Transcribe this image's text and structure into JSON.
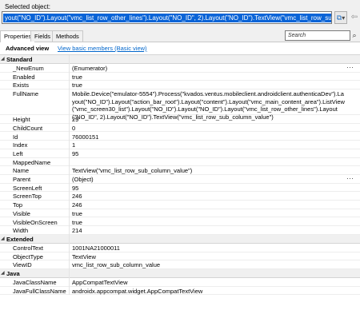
{
  "header": {
    "selected_label": "Selected object:",
    "selected_value": "yout(\"NO_ID\").Layout(\"vmc_list_row_other_lines\").Layout(\"NO_ID\", 2).Layout(\"NO_ID\").TextView(\"vmc_list_row_sub_column_value\")",
    "dropdown_glyph": "▾",
    "copy_glyph": "⧉",
    "back_glyph": "⇦"
  },
  "tabs": [
    "Properties",
    "Fields",
    "Methods"
  ],
  "search": {
    "placeholder": "Search",
    "icon": "⌕"
  },
  "advanced": {
    "title": "Advanced view",
    "link": "View basic members (Basic view)"
  },
  "sections": [
    {
      "title": "Standard",
      "caret": "◢",
      "rows": [
        {
          "name": "_NewEnum",
          "value": "(Enumerator)",
          "dots": "···"
        },
        {
          "name": "Enabled",
          "value": "true"
        },
        {
          "name": "Exists",
          "value": "true"
        },
        {
          "name": "FullName",
          "value": "Mobile.Device(\"emulator-5554\").Process(\"kvados.ventus.mobileclient.androidclient.authenticaDev\").Layout(\"NO_ID\").Layout(\"action_bar_root\").Layout(\"content\").Layout(\"vmc_main_content_area\").ListView(\"vmc_screen30_list\").Layout(\"NO_ID\").Layout(\"NO_ID\").Layout(\"vmc_list_row_other_lines\").Layout(\"NO_ID\", 2).Layout(\"NO_ID\").TextView(\"vmc_list_row_sub_column_value\")"
        },
        {
          "name": "Height",
          "value": "29"
        },
        {
          "name": "ChildCount",
          "value": "0"
        },
        {
          "name": "Id",
          "value": "76000151"
        },
        {
          "name": "Index",
          "value": "1"
        },
        {
          "name": "Left",
          "value": "95"
        },
        {
          "name": "MappedName",
          "value": ""
        },
        {
          "name": "Name",
          "value": "TextView(\"vmc_list_row_sub_column_value\")"
        },
        {
          "name": "Parent",
          "value": "(Object)",
          "dots": "···"
        },
        {
          "name": "ScreenLeft",
          "value": "95"
        },
        {
          "name": "ScreenTop",
          "value": "246"
        },
        {
          "name": "Top",
          "value": "246"
        },
        {
          "name": "Visible",
          "value": "true"
        },
        {
          "name": "VisibleOnScreen",
          "value": "true"
        },
        {
          "name": "Width",
          "value": "214"
        }
      ]
    },
    {
      "title": "Extended",
      "caret": "◢",
      "rows": [
        {
          "name": "ControlText",
          "value": "1001NA21000011"
        },
        {
          "name": "ObjectType",
          "value": "TextView"
        },
        {
          "name": "ViewID",
          "value": "vmc_list_row_sub_column_value"
        }
      ]
    },
    {
      "title": "Java",
      "caret": "◢",
      "rows": [
        {
          "name": "JavaClassName",
          "value": "AppCompatTextView"
        },
        {
          "name": "JavaFullClassName",
          "value": "androidx.appcompat.widget.AppCompatTextView"
        }
      ]
    }
  ]
}
